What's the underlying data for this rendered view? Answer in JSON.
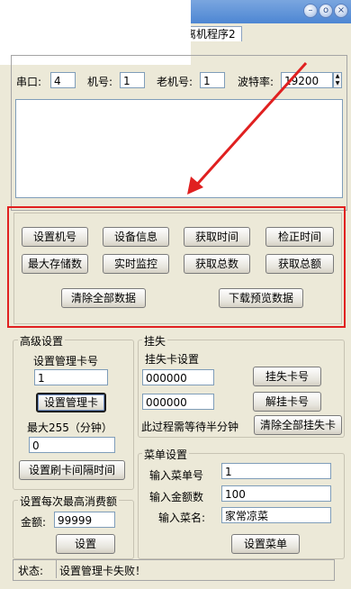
{
  "window": {
    "tab_label": "离机程序2"
  },
  "conn": {
    "port_label": "串口:",
    "port_value": "4",
    "machine_label": "机号:",
    "machine_value": "1",
    "old_machine_label": "老机号:",
    "old_machine_value": "1",
    "baud_label": "波特率:",
    "baud_value": "19200"
  },
  "actions": {
    "set_id": "设置机号",
    "device_info": "设备信息",
    "get_time": "获取时间",
    "verify_time": "检正时间",
    "max_storage": "最大存储数",
    "realtime_monitor": "实时监控",
    "get_total_count": "获取总数",
    "get_total_amount": "获取总额",
    "clear_all": "清除全部数据",
    "download_preview": "下载预览数据"
  },
  "advanced": {
    "title": "高级设置",
    "card_label": "设置管理卡号",
    "card_value": "1",
    "set_card_btn": "设置管理卡",
    "max_label": "最大255（分钟）",
    "max_value": "0",
    "interval_btn": "设置刷卡间隔时间"
  },
  "limit": {
    "title": "设置每次最高消费额",
    "amount_label": "金额:",
    "amount_value": "99999",
    "set_btn": "设置"
  },
  "lost": {
    "title": "挂失",
    "sub_label": "挂失卡设置",
    "card1": "000000",
    "card2": "000000",
    "lost_btn": "挂失卡号",
    "unlost_btn": "解挂卡号",
    "wait_note": "此过程需等待半分钟",
    "clear_all_lost_btn": "清除全部挂失卡"
  },
  "menu": {
    "title": "菜单设置",
    "no_label": "输入菜单号",
    "no_value": "1",
    "amount_label": "输入金额数",
    "amount_value": "100",
    "name_label": "输入菜名:",
    "name_value": "家常凉菜",
    "set_btn": "设置菜单"
  },
  "status": {
    "label": "状态:",
    "message": "设置管理卡失败！"
  },
  "colors": {
    "accent_red": "#e02020",
    "title_blue": "#4d86d3"
  }
}
